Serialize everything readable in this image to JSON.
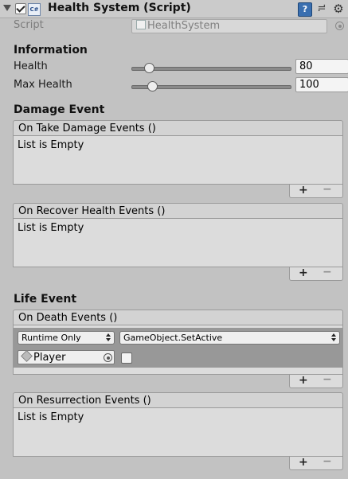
{
  "component": {
    "title": "Health System (Script)",
    "help_icon": "?",
    "presets_icon": "≓",
    "gear_icon": "⚙",
    "script_label": "Script",
    "script_value": "HealthSystem"
  },
  "information": {
    "heading": "Information",
    "health_label": "Health",
    "health_value": "80",
    "health_level": 0.08,
    "max_health_label": "Max Health",
    "max_health_value": "100",
    "max_health_level": 0.1
  },
  "damage_event": {
    "heading": "Damage Event",
    "take_damage": {
      "title": "On Take Damage Events ()",
      "body": "List is Empty"
    },
    "recover_health": {
      "title": "On Recover Health Events ()",
      "body": "List is Empty"
    }
  },
  "life_event": {
    "heading": "Life Event",
    "death": {
      "title": "On Death Events ()",
      "runtime_value": "Runtime Only",
      "function_value": "GameObject.SetActive",
      "target_object": "Player",
      "bool_checked": false
    },
    "resurrection": {
      "title": "On Resurrection Events ()",
      "body": "List is Empty"
    }
  },
  "list_controls": {
    "plus": "+",
    "minus": "−"
  }
}
